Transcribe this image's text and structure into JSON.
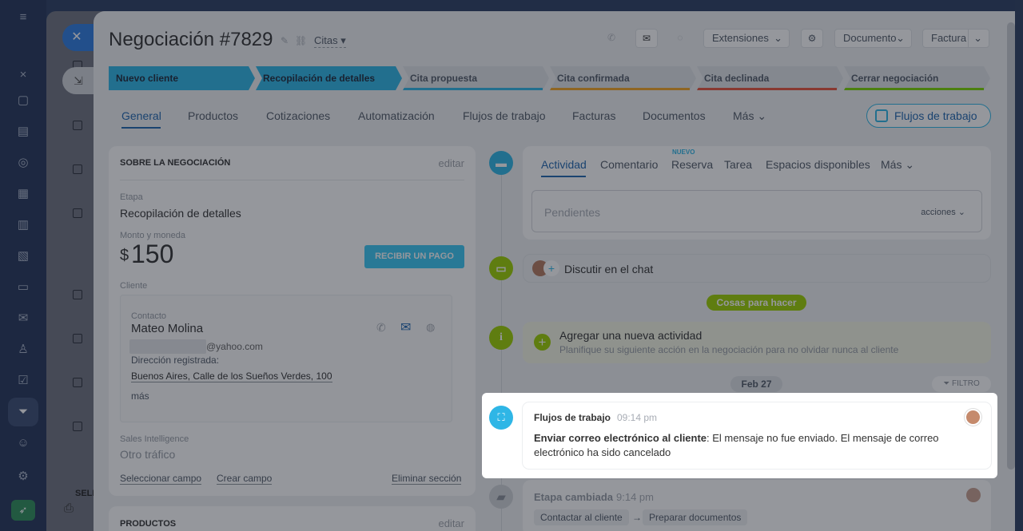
{
  "deal": {
    "title": "Negociación #7829",
    "category": "Citas"
  },
  "toolbar": {
    "extensions": "Extensiones",
    "document": "Documento",
    "invoice": "Factura"
  },
  "stages": [
    {
      "label": "Nuevo cliente",
      "active": true,
      "color": "#2fb6e6"
    },
    {
      "label": "Recopilación de detalles",
      "active": true,
      "color": "#2fb6e6"
    },
    {
      "label": "Cita propuesta",
      "active": false,
      "color": "#2fb6e6"
    },
    {
      "label": "Cita confirmada",
      "active": false,
      "color": "#f5a623"
    },
    {
      "label": "Cita declinada",
      "active": false,
      "color": "#e8543c"
    },
    {
      "label": "Cerrar negociación",
      "active": false,
      "color": "#7bd500"
    }
  ],
  "tabs": [
    "General",
    "Productos",
    "Cotizaciones",
    "Automatización",
    "Flujos de trabajo",
    "Facturas",
    "Documentos",
    "Más"
  ],
  "workflows_button": "Flujos de trabajo",
  "about": {
    "heading": "SOBRE LA NEGOCIACIÓN",
    "edit": "editar",
    "stage_label": "Etapa",
    "stage_value": "Recopilación de detalles",
    "amount_label": "Monto y moneda",
    "currency": "$",
    "amount": "150",
    "pay_button": "RECIBIR UN PAGO",
    "client_label": "Cliente",
    "contact_label": "Contacto",
    "contact_name": "Mateo Molina",
    "email_suffix": "@yahoo.com",
    "address_label": "Dirección registrada:",
    "address": "Buenos Aires, Calle de los Sueños Verdes, 100",
    "more": "más",
    "si_label": "Sales Intelligence",
    "si_value": "Otro tráfico",
    "select_field": "Seleccionar campo",
    "create_field": "Crear campo",
    "delete_section": "Eliminar sección"
  },
  "products": {
    "heading": "PRODUCTOS",
    "edit": "editar"
  },
  "activity": {
    "tabs": [
      "Actividad",
      "Comentario",
      "Reserva",
      "Tarea",
      "Espacios disponibles",
      "Más"
    ],
    "new_badge": "NUEVO",
    "pending_placeholder": "Pendientes",
    "actions": "acciones",
    "chat": "Discutir en el chat",
    "todo_pill": "Cosas para hacer",
    "add_title": "Agregar una nueva actividad",
    "add_subtitle": "Planifique su siguiente acción en la negociación para no olvidar nunca al cliente",
    "date_pill": "Feb 27",
    "filter": "FILTRO"
  },
  "event": {
    "source": "Flujos de trabajo",
    "time": "09:14 pm",
    "bold": "Enviar correo electrónico al cliente",
    "text": ": El mensaje no fue enviado. El mensaje de correo electrónico ha sido cancelado"
  },
  "stage_change": {
    "title": "Etapa cambiada",
    "time": "9:14 pm",
    "from": "Contactar al cliente",
    "to": "Preparar documentos"
  },
  "behind_list": {
    "select_label": "SELE"
  }
}
